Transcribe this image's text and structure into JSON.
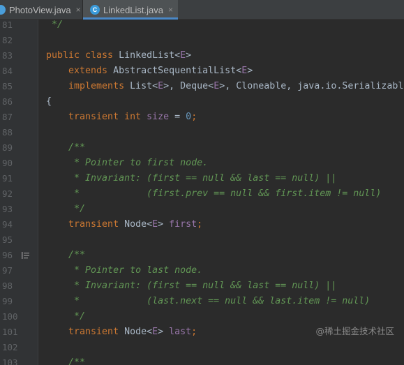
{
  "tabs": [
    {
      "label": "PhotoView.java",
      "close": "×",
      "icon": "java-file-icon"
    },
    {
      "label": "LinkedList.java",
      "close": "×",
      "icon": "class-c-icon",
      "active": true
    }
  ],
  "colors": {
    "keyword": "#cc7832",
    "type_param": "#9876aa",
    "comment": "#629755",
    "number": "#6897bb",
    "text": "#a9b7c6",
    "background": "#2b2b2b"
  },
  "lines": [
    {
      "n": "81",
      "tokens": [
        [
          "cmt",
          " */"
        ]
      ]
    },
    {
      "n": "82",
      "tokens": []
    },
    {
      "n": "83",
      "tokens": [
        [
          "kw",
          "public class "
        ],
        [
          "txt",
          "LinkedList<"
        ],
        [
          "tp",
          "E"
        ],
        [
          "txt",
          ">"
        ]
      ]
    },
    {
      "n": "84",
      "tokens": [
        [
          "kw",
          "    extends "
        ],
        [
          "txt",
          "AbstractSequentialList<"
        ],
        [
          "tp",
          "E"
        ],
        [
          "txt",
          ">"
        ]
      ]
    },
    {
      "n": "85",
      "tokens": [
        [
          "kw",
          "    implements "
        ],
        [
          "txt",
          "List<"
        ],
        [
          "tp",
          "E"
        ],
        [
          "txt",
          ">, Deque<"
        ],
        [
          "tp",
          "E"
        ],
        [
          "txt",
          ">, Cloneable, java.io.Serializabl"
        ]
      ]
    },
    {
      "n": "86",
      "tokens": [
        [
          "txt",
          "{"
        ]
      ]
    },
    {
      "n": "87",
      "tokens": [
        [
          "kw",
          "    transient int "
        ],
        [
          "fld",
          "size"
        ],
        [
          "txt",
          " = "
        ],
        [
          "num",
          "0"
        ],
        [
          "kw",
          ";"
        ]
      ]
    },
    {
      "n": "88",
      "tokens": []
    },
    {
      "n": "89",
      "tokens": [
        [
          "cmt",
          "    /**"
        ]
      ]
    },
    {
      "n": "90",
      "tokens": [
        [
          "cmt",
          "     * Pointer to first node."
        ]
      ]
    },
    {
      "n": "91",
      "tokens": [
        [
          "cmt",
          "     * Invariant: (first == null && last == null) ||"
        ]
      ]
    },
    {
      "n": "92",
      "tokens": [
        [
          "cmt",
          "     *            (first.prev == null && first.item != null)"
        ]
      ]
    },
    {
      "n": "93",
      "tokens": [
        [
          "cmt",
          "     */"
        ]
      ]
    },
    {
      "n": "94",
      "tokens": [
        [
          "kw",
          "    transient "
        ],
        [
          "txt",
          "Node<"
        ],
        [
          "tp",
          "E"
        ],
        [
          "txt",
          "> "
        ],
        [
          "fld",
          "first"
        ],
        [
          "kw",
          ";"
        ]
      ]
    },
    {
      "n": "95",
      "tokens": []
    },
    {
      "n": "96",
      "fold": true,
      "tokens": [
        [
          "cmt",
          "    /**"
        ]
      ]
    },
    {
      "n": "97",
      "tokens": [
        [
          "cmt",
          "     * Pointer to last node."
        ]
      ]
    },
    {
      "n": "98",
      "tokens": [
        [
          "cmt",
          "     * Invariant: (first == null && last == null) ||"
        ]
      ]
    },
    {
      "n": "99",
      "tokens": [
        [
          "cmt",
          "     *            (last.next == null && last.item != null)"
        ]
      ]
    },
    {
      "n": "100",
      "tokens": [
        [
          "cmt",
          "     */"
        ]
      ]
    },
    {
      "n": "101",
      "tokens": [
        [
          "kw",
          "    transient "
        ],
        [
          "txt",
          "Node<"
        ],
        [
          "tp",
          "E"
        ],
        [
          "txt",
          "> "
        ],
        [
          "fld",
          "last"
        ],
        [
          "kw",
          ";"
        ]
      ]
    },
    {
      "n": "102",
      "tokens": []
    },
    {
      "n": "103",
      "tokens": [
        [
          "cmt",
          "    /**"
        ]
      ]
    }
  ],
  "watermark": "@稀土掘金技术社区"
}
